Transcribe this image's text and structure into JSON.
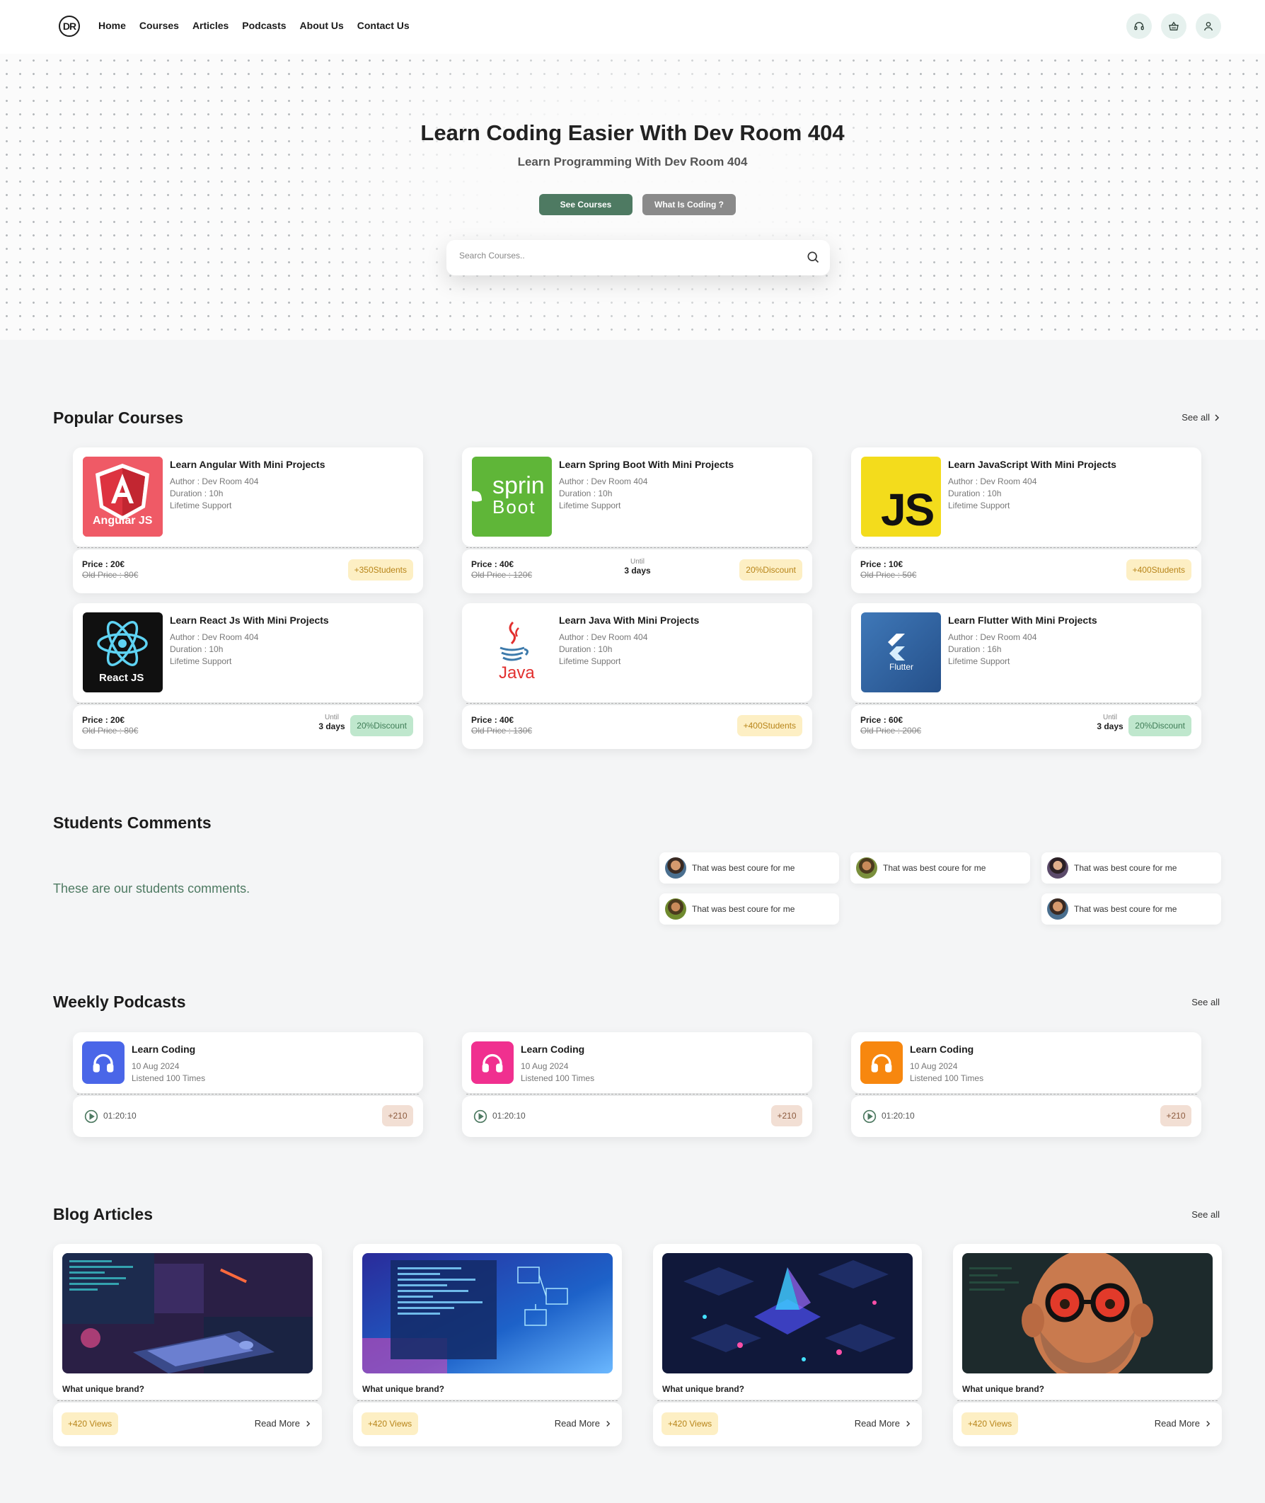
{
  "header": {
    "logo_text": "DR",
    "nav": [
      "Home",
      "Courses",
      "Articles",
      "Podcasts",
      "About Us",
      "Contact Us"
    ],
    "icons": [
      "headset-icon",
      "basket-icon",
      "user-icon"
    ]
  },
  "hero": {
    "title": "Learn Coding Easier With Dev Room 404",
    "subtitle": "Learn Programming With Dev Room 404",
    "btn_primary": "See Courses",
    "btn_secondary": "What Is Coding ?",
    "search_placeholder": "Search Courses.."
  },
  "popular": {
    "title": "Popular Courses",
    "see_all": "See all",
    "courses": [
      {
        "title": "Learn Angular With Mini Projects",
        "author": "Author : Dev Room 404",
        "duration": "Duration : 10h",
        "support": "Lifetime Support",
        "price": "Price : 20€",
        "old_price": "Old Price : 80€",
        "badge": "+350Students",
        "thumb_label": "Angular JS"
      },
      {
        "title": "Learn Spring Boot With Mini Projects",
        "author": "Author : Dev Room 404",
        "duration": "Duration : 10h",
        "support": "Lifetime Support",
        "price": "Price : 40€",
        "old_price": "Old Price : 120€",
        "until_label": "Until",
        "until_value": "3 days",
        "badge": "20%Discount",
        "thumb_label": "sprin",
        "thumb_label2": "Boot"
      },
      {
        "title": "Learn JavaScript With Mini Projects",
        "author": "Author : Dev Room 404",
        "duration": "Duration : 10h",
        "support": "Lifetime Support",
        "price": "Price : 10€",
        "old_price": "Old Price : 50€",
        "badge": "+400Students",
        "thumb_label": "JS"
      },
      {
        "title": "Learn React Js With Mini Projects",
        "author": "Author : Dev Room 404",
        "duration": "Duration : 10h",
        "support": "Lifetime Support",
        "price": "Price : 20€",
        "old_price": "Old Price : 80€",
        "until_label": "Until",
        "until_value": "3 days",
        "badge": "20%Discount",
        "thumb_label": "React JS"
      },
      {
        "title": "Learn Java With Mini Projects",
        "author": "Author : Dev Room 404",
        "duration": "Duration : 10h",
        "support": "Lifetime Support",
        "price": "Price : 40€",
        "old_price": "Old Price : 130€",
        "badge": "+400Students",
        "thumb_label": "Java"
      },
      {
        "title": "Learn Flutter With Mini Projects",
        "author": "Author : Dev Room 404",
        "duration": "Duration : 16h",
        "support": "Lifetime Support",
        "price": "Price : 60€",
        "old_price": "Old Price : 200€",
        "until_label": "Until",
        "until_value": "3 days",
        "badge": "20%Discount",
        "thumb_label": "Flutter"
      }
    ]
  },
  "comments": {
    "title": "Students Comments",
    "description": "These are our students comments.",
    "items": [
      "That was best coure for me",
      "That was best coure for me",
      "That was best coure for me",
      "That was best coure for me",
      "That was best coure for me"
    ]
  },
  "podcasts": {
    "title": "Weekly Podcasts",
    "see_all": "See all",
    "items": [
      {
        "title": "Learn Coding",
        "date": "10 Aug 2024",
        "listened": "Listened 100 Times",
        "time": "01:20:10",
        "badge": "+210",
        "color": "#4a66e8"
      },
      {
        "title": "Learn Coding",
        "date": "10 Aug 2024",
        "listened": "Listened 100 Times",
        "time": "01:20:10",
        "badge": "+210",
        "color": "#f0308f"
      },
      {
        "title": "Learn Coding",
        "date": "10 Aug 2024",
        "listened": "Listened 100 Times",
        "time": "01:20:10",
        "badge": "+210",
        "color": "#f7870f"
      }
    ]
  },
  "blog": {
    "title": "Blog Articles",
    "see_all": "See all",
    "items": [
      {
        "title": "What unique brand?",
        "views": "+420 Views",
        "read_more": "Read More"
      },
      {
        "title": "What unique brand?",
        "views": "+420 Views",
        "read_more": "Read More"
      },
      {
        "title": "What unique brand?",
        "views": "+420 Views",
        "read_more": "Read More"
      },
      {
        "title": "What unique brand?",
        "views": "+420 Views",
        "read_more": "Read More"
      }
    ]
  },
  "colors": {
    "accent_green": "#4e7a62",
    "badge_yellow": "#fdefc4",
    "badge_green": "#bfe7cd",
    "background": "#f4f5f6"
  }
}
